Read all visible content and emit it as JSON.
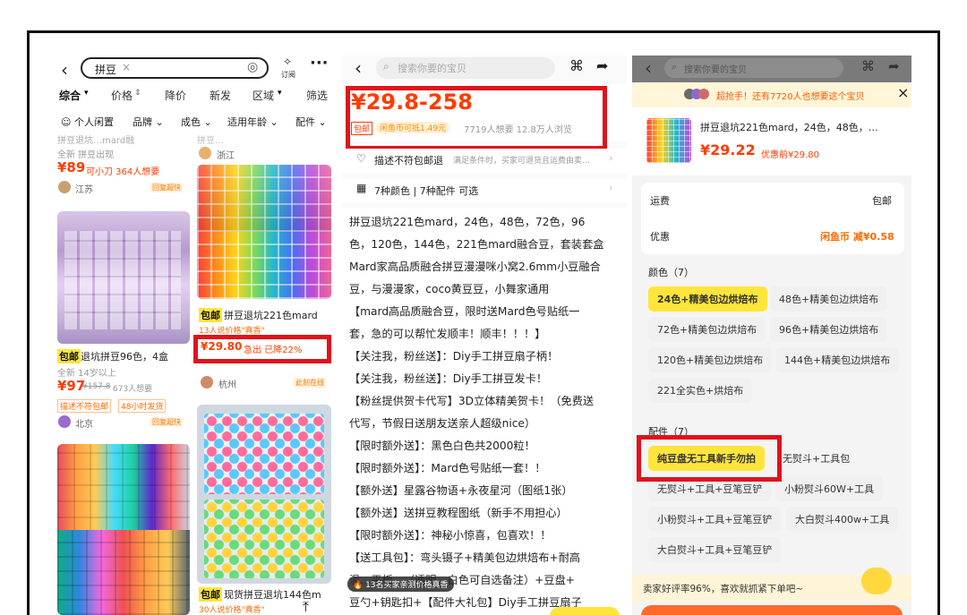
{
  "panel1": {
    "search_value": "拼豆",
    "subscribe_label": "订阅",
    "sort_tabs": [
      "综合",
      "价格",
      "降价",
      "新发",
      "区域",
      "筛选"
    ],
    "filters": [
      "个人闲置",
      "品牌",
      "成色",
      "适用年龄",
      "配件"
    ],
    "cards": [
      {
        "title": "拼豆退坑…mard融",
        "meta": "全新 拼豆出现",
        "price": "¥89",
        "note": "可小刀 364人想要",
        "seller": "江苏",
        "badge": "回复超快"
      },
      {
        "tag": "包邮",
        "title": "退坑拼豆96色，4盒",
        "meta": "全新 14岁以上",
        "price": "¥97",
        "orig": "¥157.8",
        "want": "673人想要",
        "extra": "描述不符包邮",
        "extra2": "48小时发货",
        "seller": "北京",
        "badge": "回复超快"
      },
      {
        "title": "拼豆…",
        "seller": "浙江"
      },
      {
        "tag": "包邮",
        "title": "拼豆退坑221色mard",
        "meta": "13人说价格\"真香\"",
        "price": "¥29.80",
        "note": "急出 已降22%",
        "seller": "杭州",
        "badge": "此刻在线"
      },
      {
        "tag": "包邮",
        "title": "现货拼豆退坑144色m",
        "meta": "30人说价格\"真香\""
      }
    ]
  },
  "panel2": {
    "search_placeholder": "搜索你要的宝贝",
    "price_range": "¥29.8-258",
    "tag_free_ship": "包邮",
    "coin_tag": "闲鱼币可抵1.49元",
    "stats": "7719人想要  12.8万人浏览",
    "guarantee": "描述不符包邮退",
    "guarantee_sub": "满足条件时，买家可退货且运费由卖…",
    "variants": "7种颜色 | 7种配件 可选",
    "description": [
      "拼豆退坑221色mard，24色，48色，72色，96",
      "色，120色，144色，221色mard融合豆，套装套盒",
      "Mard家高品质融合拼豆漫漫咪小窝2.6mm小豆融合",
      "豆，与漫漫家，coco黄豆豆，小舞家通用",
      "【mard高品质融合豆，限时送Mard色号贴纸一",
      "套，急的可以帮忙发顺丰！顺丰！！！】",
      "【关注我，粉丝送】：Diy手工拼豆扇子柄！",
      "【关注我，粉丝送】：Diy手工拼豆发卡！",
      "【粉丝提供贺卡代写】3D立体精美贺卡！（免费送",
      "代写，节假日送朋友送亲人超级nice）",
      "【限时额外送】：黑色白色共2000粒！",
      "【限时额外送】：Mard色号贴纸一套！！",
      "【额外送】星露谷物语+永夜星河（图纸1张）",
      "【额外送】送拼豆教程图纸（新手不用担心）",
      "【限时额外送】：神秘小惊喜，包喜欢！！",
      "【送工具包】：弯头镊子+精美包边烘焙布+耐高",
      "温…平板…（透明，白色可自选备注）+豆盘+",
      "豆勺+钥匙扣+【配件大礼包】Diy手工拼豆扇子"
    ],
    "toast": "13名买家亲测价格真香"
  },
  "panel3": {
    "search_placeholder": "搜索你要的宝贝",
    "banner": "超抢手！还有7720人也想要这个宝贝",
    "product_title": "拼豆退坑221色mard，24色，48色，…",
    "price": "¥29.22",
    "pre_price": "优惠前¥29.80",
    "shipping_label": "运费",
    "shipping_value": "包邮",
    "discount_label": "优惠",
    "discount_value": "闲鱼币 减¥0.58",
    "color_header": "颜色（7）",
    "colors": [
      "24色+精美包边烘焙布",
      "48色+精美包边烘焙布",
      "72色+精美包边烘焙布",
      "96色+精美包边烘焙布",
      "120色+精美包边烘焙布",
      "144色+精美包边烘焙布",
      "221全实色+烘焙布"
    ],
    "accessory_header": "配件（7）",
    "accessories": [
      "纯豆盘无工具新手勿拍",
      "无熨斗+工具包",
      "无熨斗+工具+豆笔豆铲",
      "小粉熨斗60W+工具",
      "小粉熨斗+工具+豆笔豆铲",
      "大白熨斗400w+工具",
      "大白熨斗+工具+豆笔豆铲"
    ],
    "footer": "卖家好评率96%，喜欢就抓紧下单吧~",
    "footer_highlight": "卖家好评率96%"
  },
  "colors": {
    "accent_red": "#e0121a",
    "price_red": "#ff3c00",
    "yellow": "#ffe53b",
    "brand_orange": "#ff6a00"
  }
}
